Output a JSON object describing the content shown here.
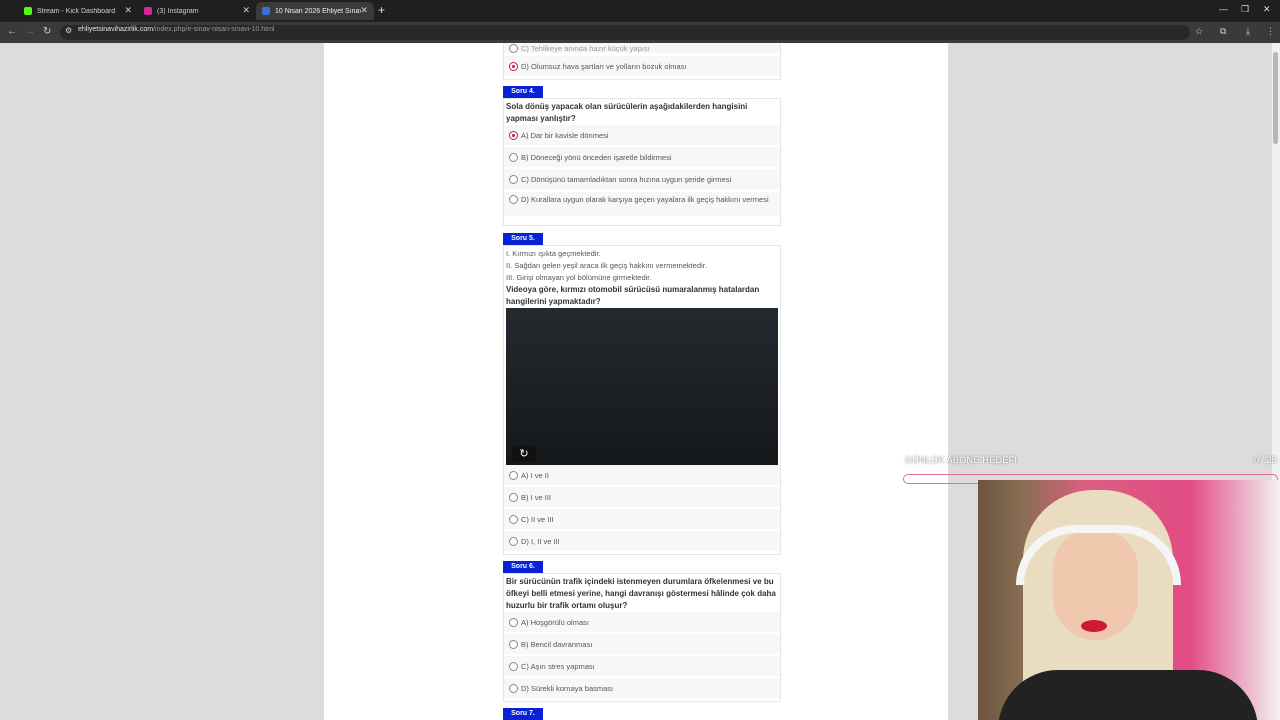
{
  "tabs": [
    {
      "title": "Stream - Kick Dashboard",
      "favicon_color": "#53fc18"
    },
    {
      "title": "(3) Instagram",
      "favicon_color": "#d6249f"
    },
    {
      "title": "10 Nisan 2026 Ehliyet Sınavı Ha",
      "favicon_color": "#3b6fd6"
    }
  ],
  "address": {
    "domain": "ehliyetsinavihazirlik.com",
    "path": "/index.php/e-sinav-nisan-sinavi-10.html"
  },
  "partial_top": {
    "option_c": "C) Tehlikeye anında hazır küçük yapısı",
    "option_d": "D) Olumsuz hava şartları ve yolların bozuk olması"
  },
  "questions": {
    "q4": {
      "label": "Soru 4.",
      "text": "Sola dönüş yapacak olan sürücülerin aşağıdakilerden hangisini yapması yanlıştır?",
      "options": [
        "A) Dar bir kavisle dönmesi",
        "B) Döneceği yönü önceden işaretle bildirmesi",
        "C) Dönüşünü tamamladıktan sonra hızına uygun şeride girmesi",
        "D) Kurallara uygun olarak karşıya geçen yayalara ilk geçiş hakkını vermesi"
      ],
      "selected_index": 0
    },
    "q5": {
      "label": "Soru 5.",
      "statements": [
        "I. Kırmızı ışıkta geçmektedir.",
        "II. Sağdan gelen yeşil araca ilk geçiş hakkını vermemektedir.",
        "III. Girişi olmayan yol bölümüne girmektedir."
      ],
      "text": "Videoya göre, kırmızı otomobil sürücüsü numaralanmış hatalardan hangilerini yapmaktadır?",
      "options": [
        "A) I ve II",
        "B) I ve III",
        "C) II ve III",
        "D) I, II ve III"
      ]
    },
    "q6": {
      "label": "Soru 6.",
      "text": "Bir sürücünün trafik içindeki istenmeyen durumlara öfkelenmesi ve bu öfkeyi belli etmesi yerine, hangi davranışı göstermesi hâlinde çok daha huzurlu bir trafik ortamı oluşur?",
      "options": [
        "A) Hoşgörülü olması",
        "B) Bencil davranması",
        "C) Aşırı stres yapması",
        "D) Sürekli kornaya basması"
      ]
    },
    "q7": {
      "label": "Soru 7."
    }
  },
  "overlay": {
    "goal_text": "GÜNLÜK ABONE HEDEFİ",
    "goal_count": "0 / 25",
    "goal_progress": 0
  },
  "colors": {
    "question_label_bg": "#0a22d6",
    "selected_radio": "#c2185b",
    "goal_bar": "#e86c9b"
  },
  "icons": [
    "back-icon",
    "forward-icon",
    "reload-icon",
    "site-info-icon",
    "star-icon",
    "extensions-icon",
    "download-icon",
    "menu-icon",
    "replay-icon"
  ]
}
